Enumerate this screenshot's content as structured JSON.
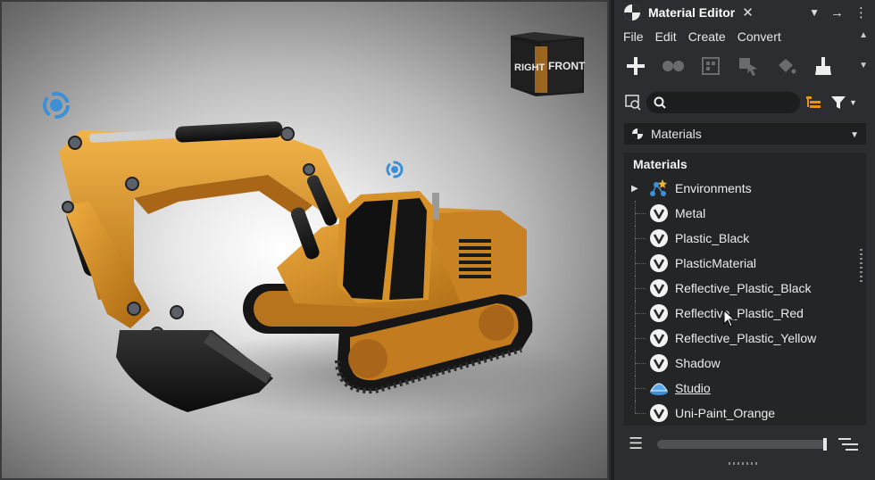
{
  "panel": {
    "title": "Material Editor",
    "menu": [
      "File",
      "Edit",
      "Create",
      "Convert"
    ],
    "search": {
      "value": "",
      "placeholder": ""
    },
    "dropdown": {
      "selected": "Materials"
    },
    "tree": {
      "header": "Materials",
      "items": [
        {
          "label": "Environments",
          "icon": "environments-icon",
          "expandable": true
        },
        {
          "label": "Metal",
          "icon": "material-v-icon"
        },
        {
          "label": "Plastic_Black",
          "icon": "material-v-icon"
        },
        {
          "label": "PlasticMaterial",
          "icon": "material-v-icon"
        },
        {
          "label": "Reflective_Plastic_Black",
          "icon": "material-v-icon"
        },
        {
          "label": "Reflective_Plastic_Red",
          "icon": "material-v-icon"
        },
        {
          "label": "Reflective_Plastic_Yellow",
          "icon": "material-v-icon"
        },
        {
          "label": "Shadow",
          "icon": "material-v-icon"
        },
        {
          "label": "Studio",
          "icon": "studio-dome-icon"
        },
        {
          "label": "Uni-Paint_Orange",
          "icon": "material-v-icon"
        }
      ]
    }
  },
  "viewport": {
    "viewcube": {
      "left_face": "RIGHT",
      "front_face": "FRONT"
    }
  },
  "colors": {
    "accent_orange": "#e88f1a",
    "excavator_yellow": "#d9952c",
    "icon_blue": "#3d8fd6"
  }
}
